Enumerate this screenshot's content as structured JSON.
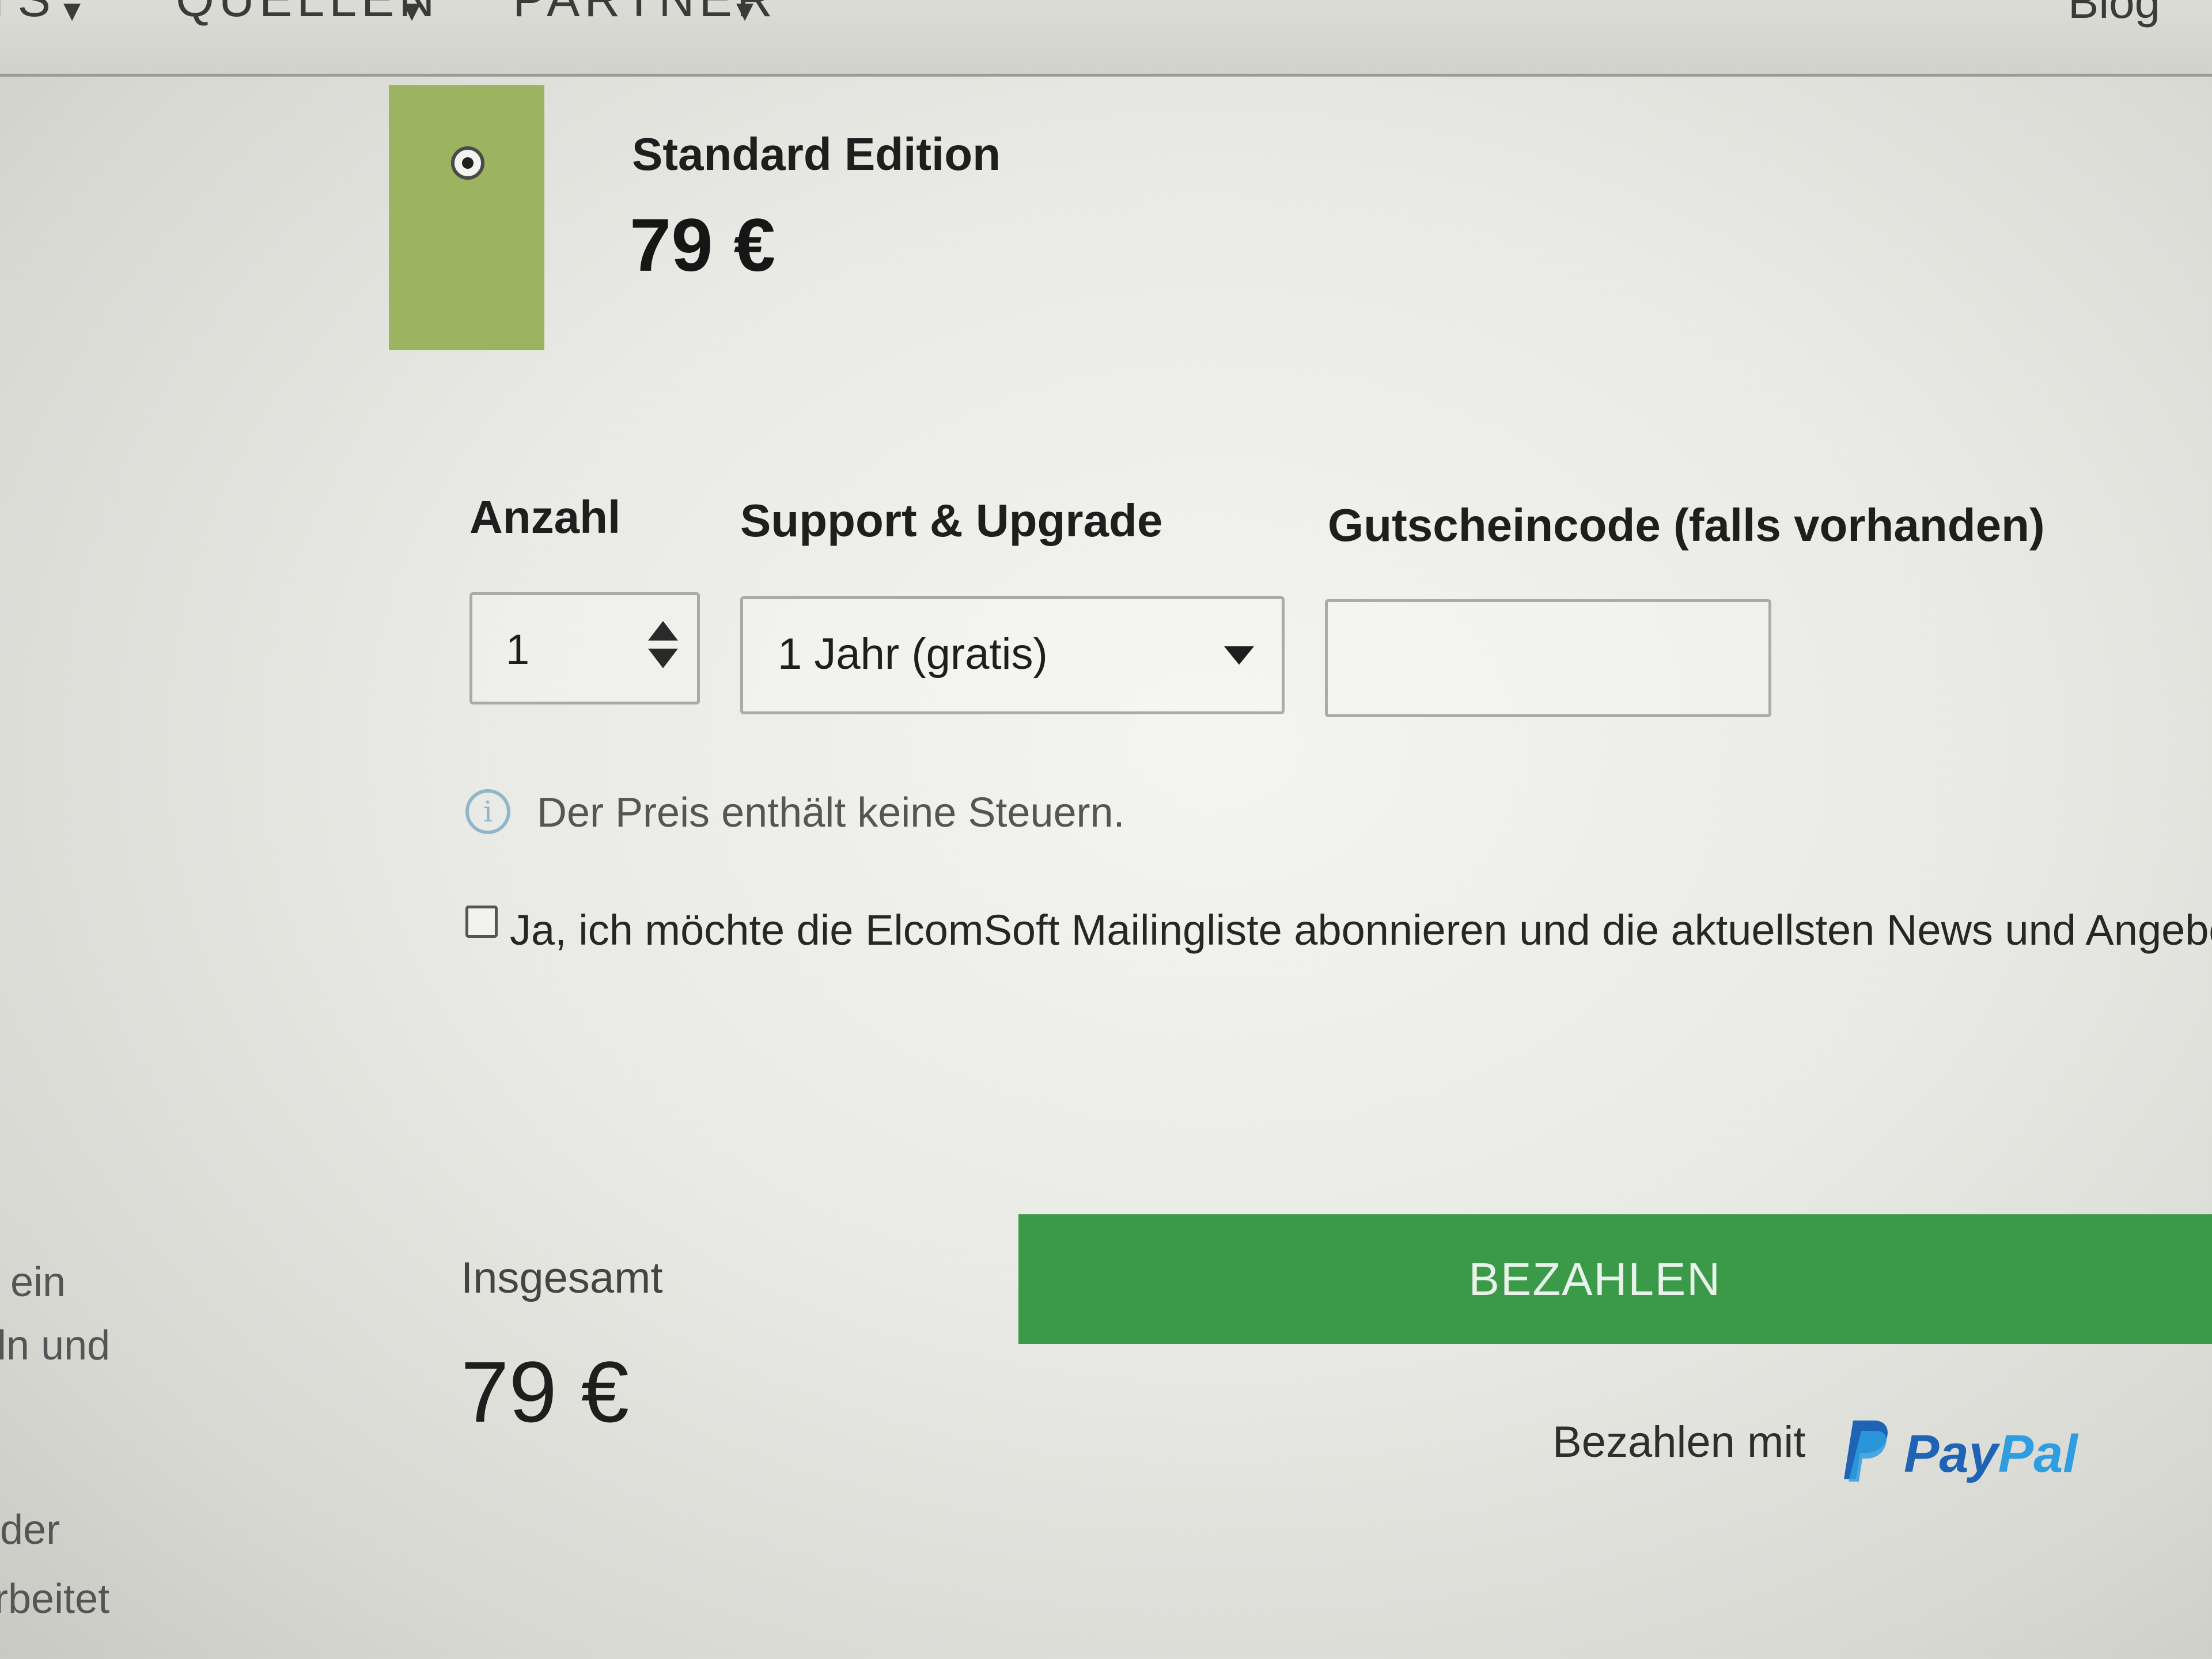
{
  "nav": {
    "items": [
      {
        "label": "TS",
        "chevron": "▾"
      },
      {
        "label": "QUELLEN",
        "chevron": "▾"
      },
      {
        "label": "PARTNER",
        "chevron": "▾"
      }
    ],
    "blog_label": "Blog"
  },
  "edition": {
    "name": "Standard Edition",
    "price": "79 €",
    "selected": true,
    "color": "#9cb45f"
  },
  "form": {
    "quantity_label": "Anzahl",
    "quantity_value": "1",
    "support_label": "Support & Upgrade",
    "support_value": "1 Jahr (gratis)",
    "coupon_label": "Gutscheincode (falls vorhanden)",
    "coupon_value": ""
  },
  "info": {
    "icon": "info-icon",
    "text": "Der Preis enthält keine Steuern."
  },
  "newsletter": {
    "checked": false,
    "label": "Ja, ich möchte die ElcomSoft Mailingliste abonnieren und die aktuellsten News und Angebote e"
  },
  "sidebar_fragments": [
    "ein",
    "eln und",
    "der",
    "rbeitet"
  ],
  "total": {
    "label": "Insgesamt",
    "value": "79 €"
  },
  "pay": {
    "button_label": "BEZAHLEN",
    "button_color": "#3a9a47",
    "paywith_label": "Bezahlen mit",
    "paypal_word_1": "Pay",
    "paypal_word_2": "Pal",
    "paypal_colors": [
      "#1f63b5",
      "#2e9ee0"
    ]
  }
}
